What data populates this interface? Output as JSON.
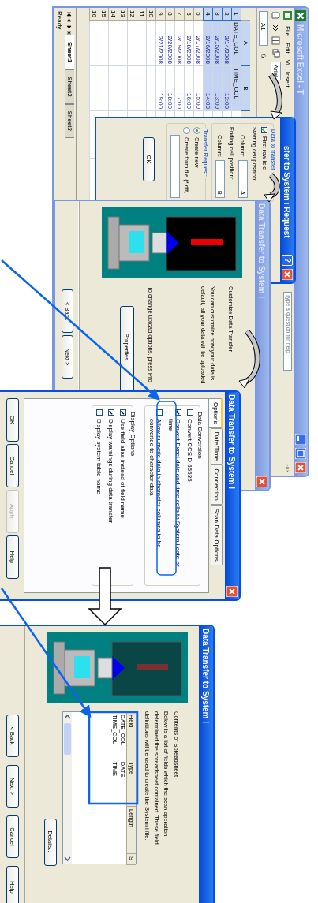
{
  "excel": {
    "title": "Microsoft Excel - T",
    "active": false,
    "menu": [
      "File",
      "Edit",
      "Vi",
      "Insert"
    ],
    "font_box": "Arial",
    "name_box": "A1",
    "formula_label": "fx",
    "help_search": {
      "placeholder": "Type a question for help"
    },
    "columns": [
      {
        "label": "A",
        "selected": true
      },
      {
        "label": "B",
        "selected": true
      }
    ],
    "rows": [
      {
        "number": "1",
        "selected": true,
        "kind": "text",
        "cells": [
          "DATE_COL",
          "TIME_COL"
        ]
      },
      {
        "number": "2",
        "selected": true,
        "kind": "value",
        "cells": [
          "2/14/2008",
          "12:00"
        ]
      },
      {
        "number": "3",
        "selected": true,
        "kind": "value",
        "cells": [
          "2/15/2008",
          "13:00"
        ]
      },
      {
        "number": "4",
        "selected": true,
        "kind": "value",
        "cells": [
          "2/16/2008",
          "14:00"
        ]
      },
      {
        "number": "5",
        "selected": false,
        "kind": "value",
        "cells": [
          "2/17/2008",
          "15:00"
        ]
      },
      {
        "number": "6",
        "selected": false,
        "kind": "value",
        "cells": [
          "2/18/2008",
          "16:00"
        ]
      },
      {
        "number": "7",
        "selected": false,
        "kind": "value",
        "cells": [
          "2/19/2008",
          "17:00"
        ]
      },
      {
        "number": "8",
        "selected": false,
        "kind": "value",
        "cells": [
          "2/20/2008",
          "18:00"
        ]
      },
      {
        "number": "9",
        "selected": false,
        "kind": "value",
        "cells": [
          "2/21/2008",
          "19:00"
        ]
      },
      {
        "number": "10",
        "selected": false
      },
      {
        "number": "11",
        "selected": false
      },
      {
        "number": "12",
        "selected": false
      },
      {
        "number": "13",
        "selected": false
      },
      {
        "number": "14",
        "selected": false
      },
      {
        "number": "15",
        "selected": false
      },
      {
        "number": "16",
        "selected": false
      }
    ],
    "sheet_tabs": [
      {
        "label": "Sheet1",
        "selected": true
      },
      {
        "label": "Sheet2",
        "selected": false
      },
      {
        "label": "Sheet3",
        "selected": false
      }
    ],
    "status": "Ready"
  },
  "request_dialog": {
    "title": "sfer to System i Request",
    "active": true,
    "help_button": "?",
    "group_title": "Data to transfer",
    "first_row": {
      "label": "First row is c",
      "checked": true
    },
    "start_label": "Starting cell position:",
    "start_column": {
      "label": "Column:",
      "value": "A"
    },
    "end_label": "Ending cell position:",
    "end_column": {
      "label": "Column:",
      "value": "B"
    },
    "request_title": "Transfer Request:",
    "options": [
      {
        "label": "Create new",
        "selected": true
      },
      {
        "label": "Create from file (*.dtt,",
        "selected": false
      }
    ],
    "ok": "OK"
  },
  "wizard_step": {
    "title": "Data Transfer to System i",
    "active": false,
    "illustration": {
      "dimmed": false
    },
    "heading": "Customize Data Transfer",
    "lines": [
      "You can customize how your data is",
      "default, all your data will be uploaded"
    ],
    "note": "To change upload options, press Pro",
    "properties": "Properties...",
    "back": "< Back",
    "next": "Next >"
  },
  "properties_dialog": {
    "title": "Data Transfer to System i",
    "active": true,
    "tabs": [
      {
        "label": "Options",
        "selected": true
      },
      {
        "label": "Date/Time",
        "selected": false
      },
      {
        "label": "Connection",
        "selected": false
      },
      {
        "label": "Scan Data Options",
        "selected": false
      }
    ],
    "groups": [
      {
        "title": "Data Conversion",
        "items": [
          {
            "label": "Convert CCSID 65535",
            "checked": false
          },
          {
            "label": "Convert Excel date and time cells to System i date or time",
            "checked": true
          },
          {
            "label": "Allow numeric data in character columns to be converted to character data",
            "checked": false
          }
        ]
      },
      {
        "title": "Display Options",
        "items": [
          {
            "label": "Use field alias instead of field name",
            "checked": true
          },
          {
            "label": "Display warnings during data transfer",
            "checked": true
          },
          {
            "label": "Display system table name",
            "checked": false
          }
        ]
      }
    ],
    "buttons": [
      {
        "label": "OK",
        "disabled": false
      },
      {
        "label": "Cancel",
        "disabled": false
      },
      {
        "label": "Apply",
        "disabled": true
      },
      {
        "label": "Help",
        "disabled": false
      }
    ]
  },
  "final_step": {
    "title": "Data Transfer to System i",
    "active": true,
    "illustration": {
      "dimmed": true
    },
    "heading": "Contents of Spreadsheet",
    "description": "Below is a list of fields which the scan operation determined the spreadsheet contained.  These field definitions will be used to create the System i file.",
    "columns": [
      "Field",
      "Type",
      "Length",
      "S"
    ],
    "fields": [
      {
        "field": "DATE_COL",
        "type": "DATE"
      },
      {
        "field": "TIME_COL",
        "type": "TIME"
      }
    ],
    "details": "Details...",
    "buttons": [
      "< Back",
      "Next >",
      "Cancel",
      "Help"
    ]
  }
}
